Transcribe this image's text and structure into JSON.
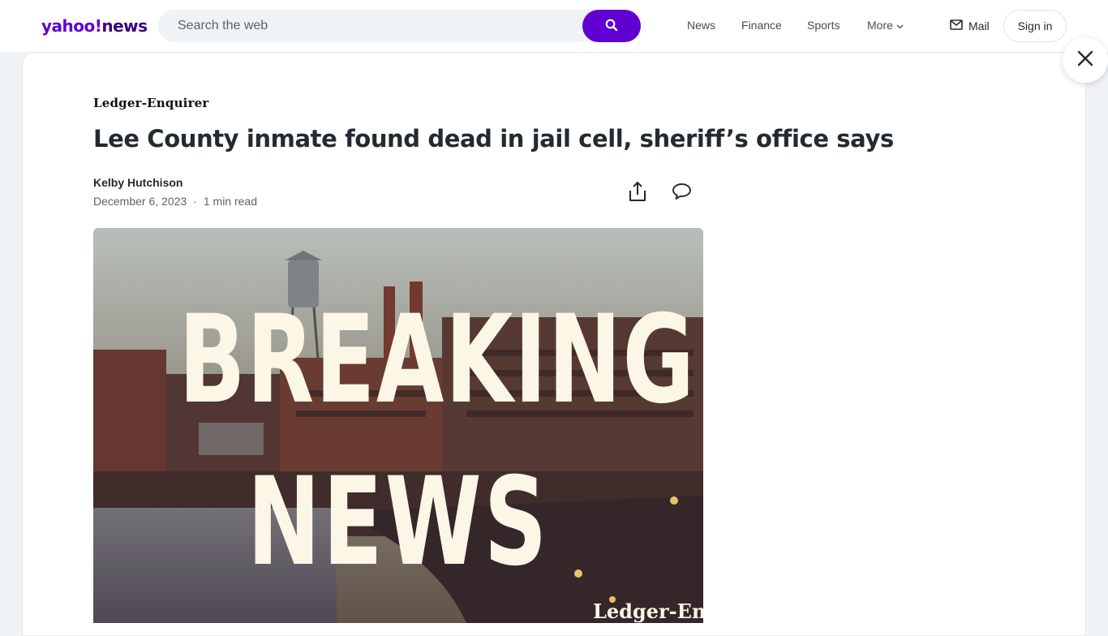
{
  "header": {
    "logo_yahoo": "yahoo!",
    "logo_news": "news",
    "search_placeholder": "Search the web",
    "nav": [
      {
        "label": "News"
      },
      {
        "label": "Finance"
      },
      {
        "label": "Sports"
      },
      {
        "label": "More"
      }
    ],
    "mail_label": "Mail",
    "signin_label": "Sign in"
  },
  "article": {
    "publisher": "Ledger-Enquirer",
    "headline": "Lee County inmate found dead in jail cell, sheriff’s office says",
    "author": "Kelby Hutchison",
    "date": "December 6, 2023",
    "separator": "·",
    "read_time": "1 min read",
    "hero_image": {
      "line1": "BREAKING",
      "line2": "NEWS",
      "watermark": "Ledger-Enq"
    }
  },
  "icons": [
    "search-icon",
    "chevron-down-icon",
    "mail-icon",
    "close-icon",
    "share-icon",
    "comment-icon"
  ],
  "colors": {
    "brand_purple": "#6001d2",
    "logo_news": "#39007d",
    "page_bg": "#f0f3f5",
    "text_primary": "#232a31",
    "text_secondary": "#5b636a"
  }
}
